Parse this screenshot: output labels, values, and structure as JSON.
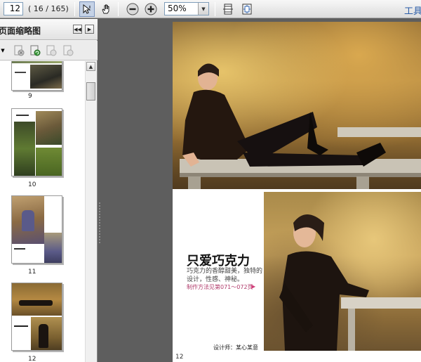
{
  "toolbar": {
    "page_number": "12",
    "page_count": "( 16 / 165)",
    "zoom": "50%",
    "tools_label": "工具"
  },
  "sidebar": {
    "title": "页面缩略图",
    "thumbnails": [
      {
        "page_label": "9"
      },
      {
        "page_label": "10"
      },
      {
        "page_label": "11"
      },
      {
        "page_label": "12"
      }
    ]
  },
  "page": {
    "title": "只爱巧克力",
    "description": "巧克力的香醇甜美，独特的设计，性感、神秘。",
    "method": "制作方法见第071～072页",
    "designer": "设计师：某心某意",
    "page_number": "12"
  },
  "colors": {
    "accent_blue": "#2a5ca8",
    "method_pink": "#b03a6a"
  }
}
